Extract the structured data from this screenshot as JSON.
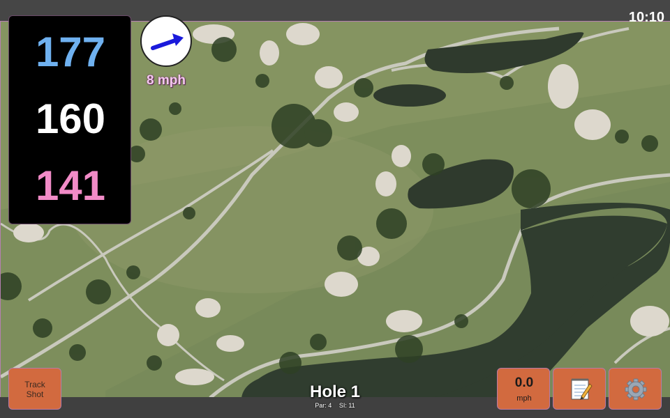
{
  "status": {
    "time": "10:10"
  },
  "distances": {
    "back": "177",
    "center": "160",
    "front": "141"
  },
  "wind": {
    "speed_label": "8 mph",
    "arrow_color": "#1a1adb"
  },
  "hole": {
    "title": "Hole 1",
    "par_label": "Par: 4",
    "si_label": "SI: 11"
  },
  "buttons": {
    "track_shot_line1": "Track",
    "track_shot_line2": "Shot",
    "speed_value": "0.0",
    "speed_unit": "mph",
    "notes_icon": "notepad-icon",
    "settings_icon": "gear-icon"
  },
  "colors": {
    "accent_button": "#d26a3f",
    "back_distance": "#6fb1f0",
    "center_distance": "#ffffff",
    "front_distance": "#f18bc7",
    "wind_label": "#f4c8ef"
  }
}
